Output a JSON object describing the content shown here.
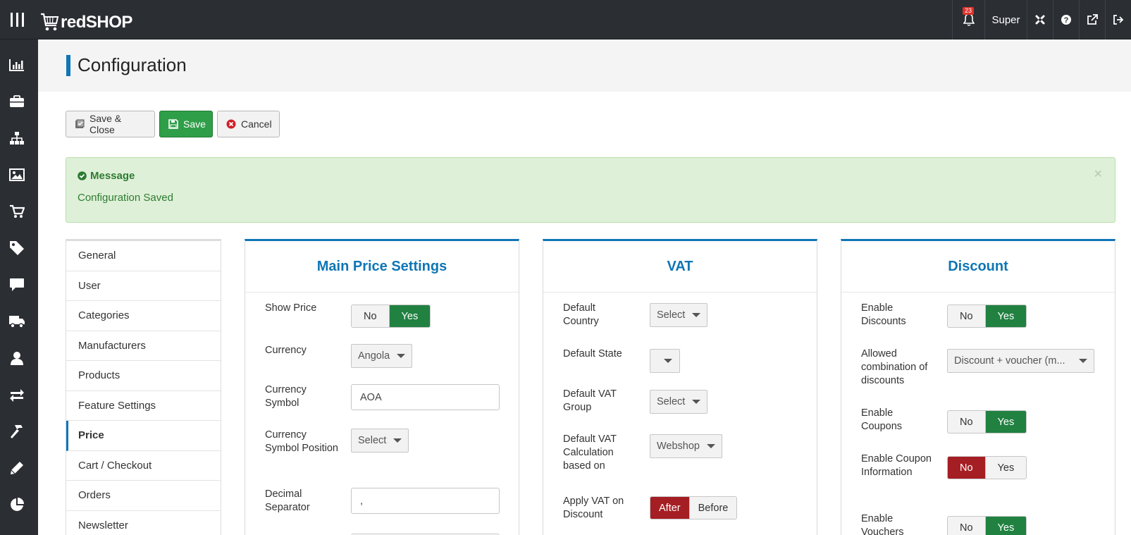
{
  "topbar": {
    "logo_text": "redSHOP",
    "notification_count": "23",
    "user_label": "Super"
  },
  "page": {
    "title": "Configuration"
  },
  "toolbar": {
    "save_close_label": "Save & Close",
    "save_label": "Save",
    "cancel_label": "Cancel"
  },
  "alert": {
    "title": "Message",
    "text": "Configuration Saved",
    "close": "×"
  },
  "tabs": [
    {
      "label": "General"
    },
    {
      "label": "User"
    },
    {
      "label": "Categories"
    },
    {
      "label": "Manufacturers"
    },
    {
      "label": "Products"
    },
    {
      "label": "Feature Settings"
    },
    {
      "label": "Price"
    },
    {
      "label": "Cart / Checkout"
    },
    {
      "label": "Orders"
    },
    {
      "label": "Newsletter"
    }
  ],
  "active_tab": "Price",
  "main_price": {
    "title": "Main Price Settings",
    "show_price_label": "Show Price",
    "show_price_no": "No",
    "show_price_yes": "Yes",
    "currency_label": "Currency",
    "currency_value": "Angola",
    "currency_symbol_label": "Currency Symbol",
    "currency_symbol_value": "AOA",
    "symbol_position_label": "Currency Symbol Position",
    "symbol_position_value": "Select",
    "decimal_separator_label": "Decimal Separator",
    "decimal_separator_value": ","
  },
  "vat": {
    "title": "VAT",
    "default_country_label": "Default Country",
    "default_country_value": "Select",
    "default_state_label": "Default State",
    "default_vat_group_label": "Default VAT Group",
    "default_vat_group_value": "Select",
    "vat_calc_label": "Default VAT Calculation based on",
    "vat_calc_value": "Webshop",
    "apply_vat_label": "Apply VAT on Discount",
    "apply_vat_after": "After",
    "apply_vat_before": "Before"
  },
  "discount": {
    "title": "Discount",
    "enable_discounts_label": "Enable Discounts",
    "allowed_combination_label": "Allowed combination of discounts",
    "allowed_combination_value": "Discount + voucher (m...",
    "enable_coupons_label": "Enable Coupons",
    "enable_coupon_info_label": "Enable Coupon Information",
    "enable_vouchers_label": "Enable Vouchers",
    "no": "No",
    "yes": "Yes"
  },
  "colors": {
    "topbar": "#2b2e33",
    "accent": "#0f76b5",
    "success": "#2f9e49",
    "toggle_on": "#208141",
    "toggle_off_red": "#a51e23",
    "alert_bg": "#dff0d8"
  },
  "icons": {
    "sidebar": [
      "chart-bar-icon",
      "briefcase-icon",
      "sitemap-icon",
      "image-icon",
      "cart-icon",
      "tag-icon",
      "comment-icon",
      "truck-icon",
      "user-icon",
      "exchange-icon",
      "hammer-icon",
      "pencil-icon",
      "pie-chart-icon"
    ],
    "topbar": [
      "menu-icon",
      "bell-icon",
      "joomla-icon",
      "help-icon",
      "external-link-icon",
      "logout-icon"
    ]
  }
}
